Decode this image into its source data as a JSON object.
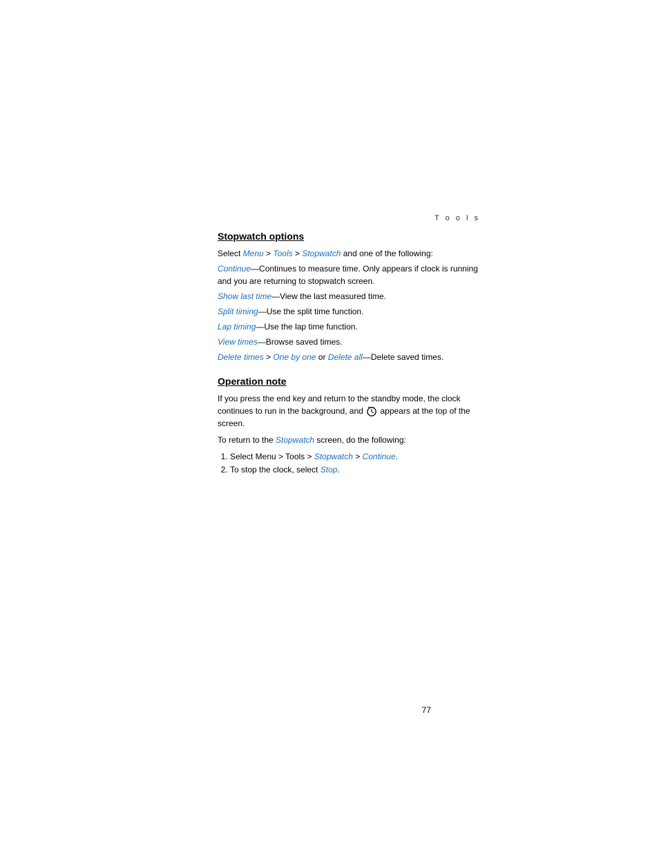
{
  "header": {
    "section_label": "T o o l s"
  },
  "stopwatch_options": {
    "title": "Stopwatch options",
    "intro": {
      "prefix": "Select ",
      "menu": "Menu",
      "sep1": " > ",
      "tools": "Tools",
      "sep2": " > ",
      "stopwatch": "Stopwatch",
      "suffix": " and one of the following:"
    },
    "items": [
      {
        "link": "Continue",
        "text": "—Continues to measure time. Only appears if clock is running and you are returning to stopwatch screen."
      },
      {
        "link": "Show last time",
        "text": "—View the last measured time."
      },
      {
        "link": "Split timing",
        "text": "—Use the split time function."
      },
      {
        "link": "Lap timing",
        "text": "—Use the lap time function."
      },
      {
        "link": "View times",
        "text": "—Browse saved times."
      },
      {
        "link": "Delete times",
        "sep": " > ",
        "link2": "One by one",
        "or": " or ",
        "link3": "Delete all",
        "text": "—Delete saved times."
      }
    ]
  },
  "operation_note": {
    "title": "Operation note",
    "body1_prefix": "If you press the end key and return to the standby mode, the clock continues to run in the background, and ",
    "body1_suffix": " appears at the top of the screen.",
    "body2_prefix": "To return to the ",
    "body2_link": "Stopwatch",
    "body2_suffix": " screen, do the following:",
    "steps": [
      {
        "number": "1.",
        "prefix": "Select Menu > Tools > ",
        "link1": "Stopwatch",
        "sep": " > ",
        "link2": "Continue",
        "suffix": "."
      },
      {
        "number": "2.",
        "prefix": "To stop the clock, select ",
        "link": "Stop",
        "suffix": "."
      }
    ]
  },
  "page_number": "77"
}
